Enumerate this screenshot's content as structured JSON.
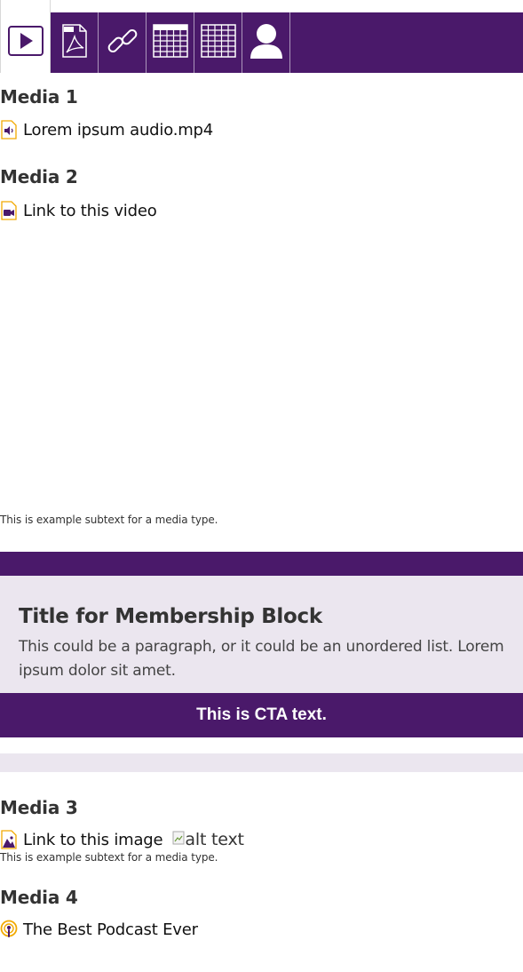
{
  "tabs": [
    {
      "icon": "play-icon"
    },
    {
      "icon": "pdf-icon"
    },
    {
      "icon": "link-icon"
    },
    {
      "icon": "grid-small-icon"
    },
    {
      "icon": "grid-large-icon"
    },
    {
      "icon": "user-icon"
    }
  ],
  "media1": {
    "title": "Media 1",
    "link": "Lorem ipsum audio.mp4"
  },
  "media2": {
    "title": "Media 2",
    "link": "Link to this video",
    "subtext": "This is example subtext for a media type."
  },
  "membership": {
    "title": "Title for Membership Block",
    "text": "This could be a paragraph, or it could be an unordered list. Lorem ipsum dolor sit amet.",
    "cta": "This is CTA text."
  },
  "media3": {
    "title": "Media 3",
    "link": "Link to this image",
    "alt": "alt text",
    "subtext": "This is example subtext for a media type."
  },
  "media4": {
    "title": "Media 4",
    "link": "The Best Podcast Ever"
  },
  "colors": {
    "brand": "#4a196a",
    "panel": "#ebe6ef",
    "accent": "#f2a900"
  }
}
